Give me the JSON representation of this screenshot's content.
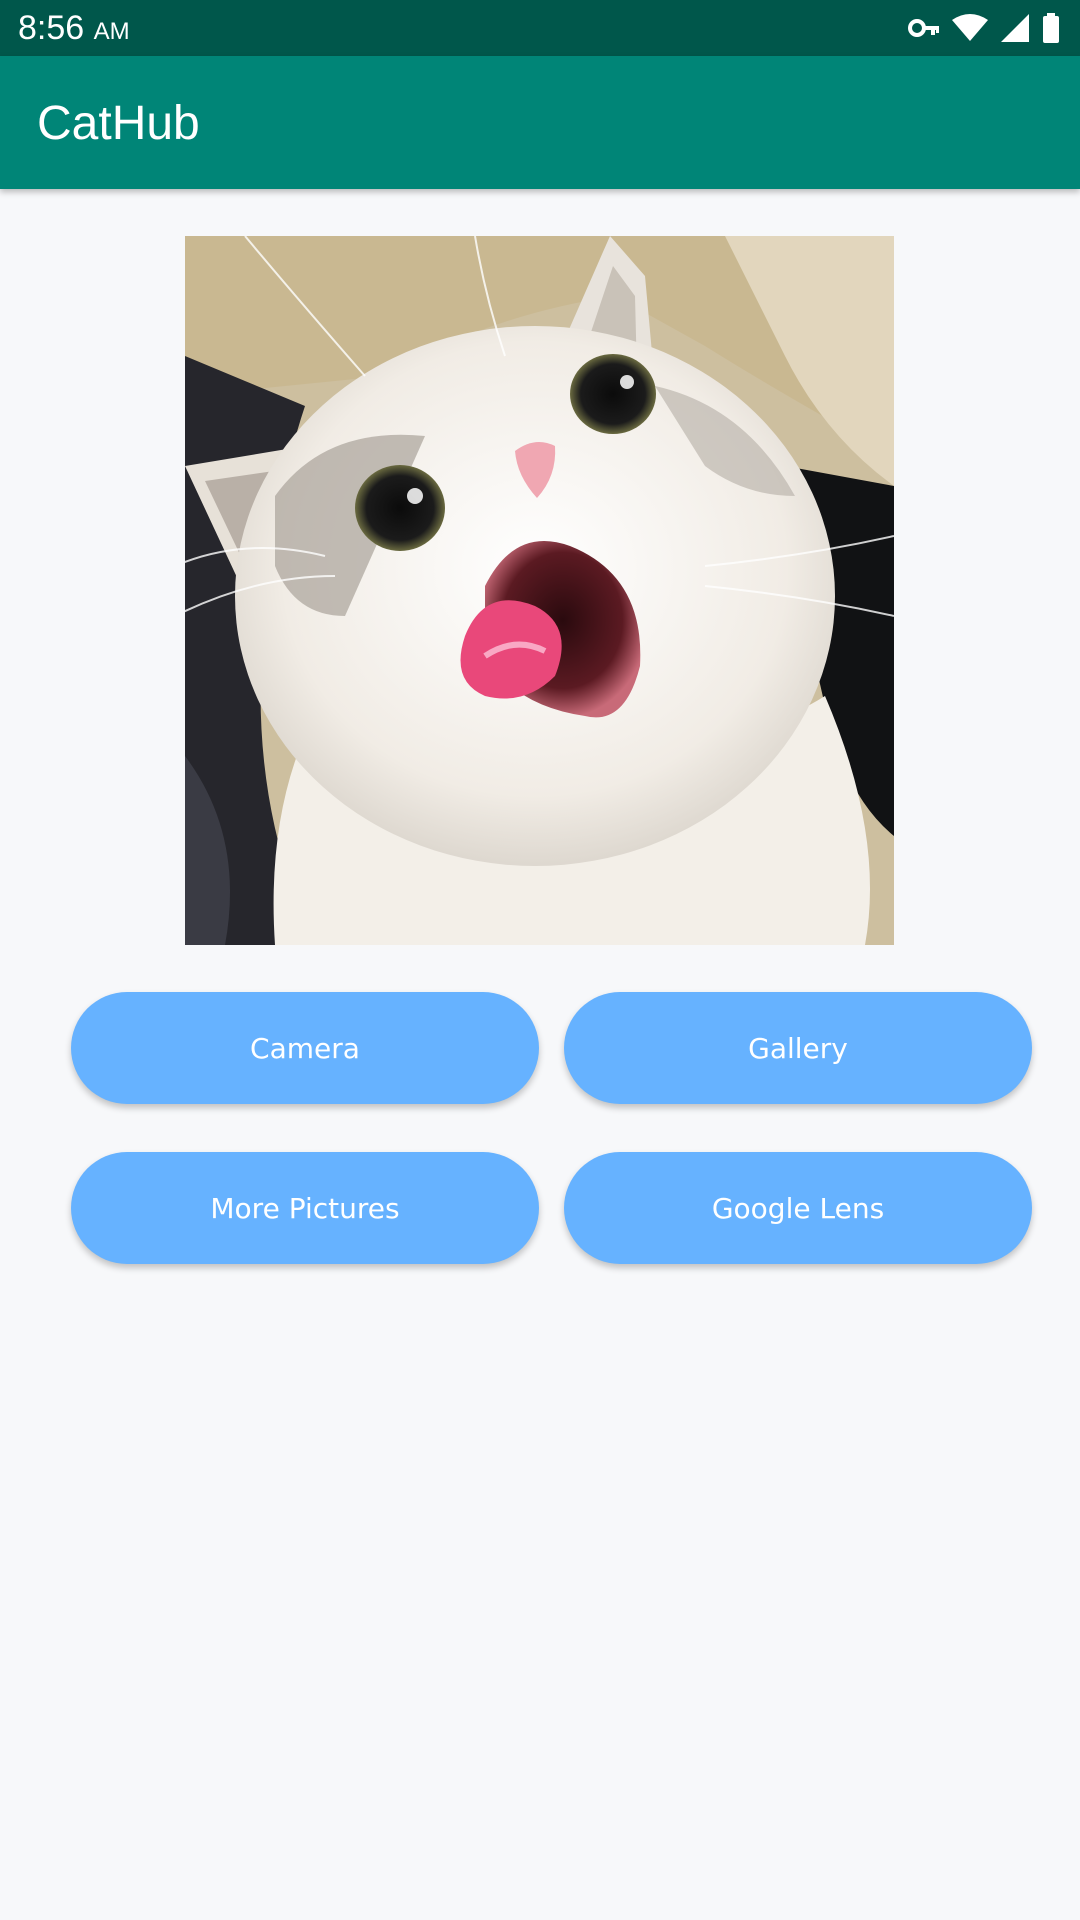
{
  "status_bar": {
    "time": "8:56",
    "ampm": "AM",
    "icons": [
      "vpn-key-icon",
      "wifi-icon",
      "cell-signal-icon",
      "battery-icon"
    ],
    "background": "#00574b"
  },
  "app_bar": {
    "title": "CatHub",
    "background": "#008577"
  },
  "main": {
    "image": {
      "description_icon": "cat-photo"
    },
    "buttons": [
      {
        "label": "Camera"
      },
      {
        "label": "Gallery"
      },
      {
        "label": "More Pictures"
      },
      {
        "label": "Google Lens"
      }
    ],
    "button_color": "#66b2ff",
    "background": "#f7f8fa"
  }
}
